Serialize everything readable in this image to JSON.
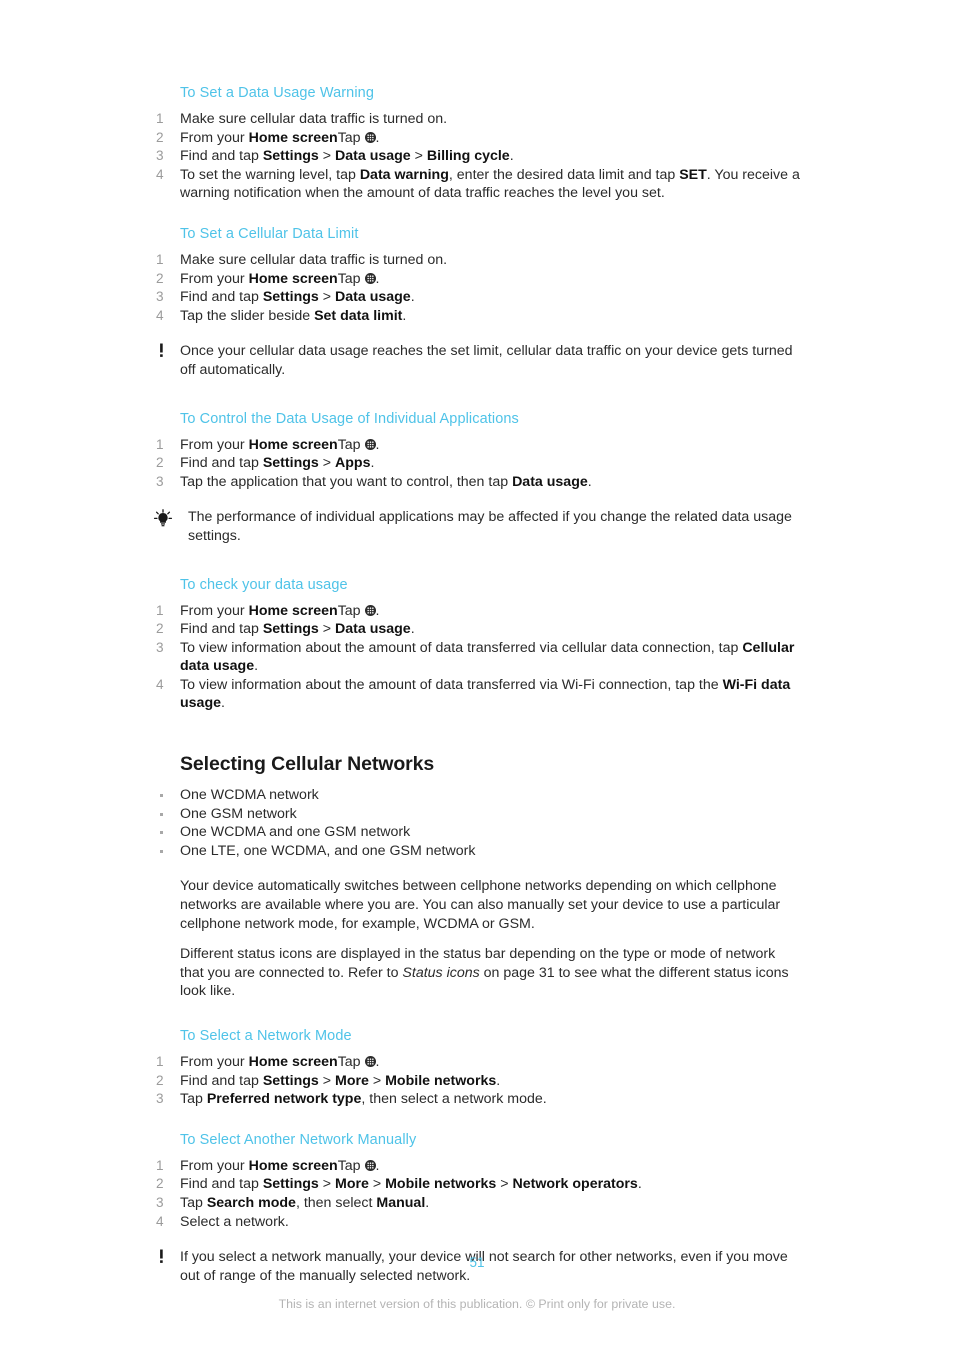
{
  "document": {
    "page_number": "51",
    "footer_note": "This is an internet version of this publication. © Print only for private use.",
    "accent_color": "#4FC3E8",
    "body_color": "#2b2b2b"
  },
  "sections": [
    {
      "id": "data-usage-warning",
      "heading": "To Set a Data Usage Warning",
      "steps": [
        {
          "num": "1",
          "text": "Make sure cellular data traffic is turned on."
        },
        {
          "num": "2",
          "text": "From your Home screen, tap [app-drawer-icon]."
        },
        {
          "num": "3",
          "text": "Find and tap Settings > Data usage > Billing cycle."
        },
        {
          "num": "4",
          "text": "To set the warning level, tap Data warning, enter the desired data limit and tap SET. You receive a warning notification when the amount of data traffic reaches the level you set."
        }
      ]
    },
    {
      "id": "cellular-data-limit",
      "heading": "To Set a Cellular Data Limit",
      "steps": [
        {
          "num": "1",
          "text": "Make sure cellular data traffic is turned on."
        },
        {
          "num": "2",
          "text": "From your Home screen, tap [app-drawer-icon]."
        },
        {
          "num": "3",
          "text": "Find and tap Settings > Data usage."
        },
        {
          "num": "4",
          "text": "Tap the slider beside Set data limit."
        }
      ],
      "note": {
        "type": "warning",
        "icon": "exclamation-icon",
        "text": "Once your cellular data usage reaches the set limit, cellular data traffic on your device gets turned off automatically."
      }
    },
    {
      "id": "control-individual-applications",
      "heading": "To Control the Data Usage of Individual Applications",
      "steps": [
        {
          "num": "1",
          "text": "From your Home screen, tap [app-drawer-icon]."
        },
        {
          "num": "2",
          "text": "Find and tap Settings > Apps."
        },
        {
          "num": "3",
          "text": "Tap the application that you want to control, then tap Data usage."
        }
      ],
      "note": {
        "type": "tip",
        "icon": "lightbulb-icon",
        "text": "The performance of individual applications may be affected if you change the related data usage settings."
      }
    },
    {
      "id": "check-your-data-usage",
      "heading": "To check your data usage",
      "steps": [
        {
          "num": "1",
          "text": "From your Home screen, tap [app-drawer-icon]."
        },
        {
          "num": "2",
          "text": "Find and tap Settings > Data usage."
        },
        {
          "num": "3",
          "text": "To view information about the amount of data transferred via cellular data connection, tap Cellular data usage."
        },
        {
          "num": "4",
          "text": "To view information about the amount of data transferred via Wi-Fi connection, tap the Wi-Fi data usage."
        }
      ]
    }
  ],
  "main_section": {
    "heading": "Selecting Cellular Networks",
    "bullets": [
      "One WCDMA network",
      "One GSM network",
      "One WCDMA and one GSM network",
      "One LTE, one WCDMA, and one GSM network"
    ],
    "paragraphs": [
      "Your device automatically switches between cellphone networks depending on which cellphone networks are available where you are. You can also manually set your device to use a particular cellphone network mode, for example, WCDMA or GSM.",
      "Different status icons are displayed in the status bar depending on the type or mode of network that you are connected to. Refer to Status icons on page 31 to see what the different status icons look like."
    ],
    "paragraph2_parts": {
      "lead": "Different status icons are displayed in the status bar depending on the type or mode of network that you are connected to. Refer to ",
      "italic_ref": "Status icons",
      "tail": " on page 31 to see what the different status icons look like."
    }
  },
  "sections_after": [
    {
      "id": "select-network-mode",
      "heading": "To Select a Network Mode",
      "steps": [
        {
          "num": "1",
          "text": "From your Home screen, tap [app-drawer-icon]."
        },
        {
          "num": "2",
          "text": "Find and tap Settings > More > Mobile networks."
        },
        {
          "num": "3",
          "text": "Tap Preferred network type, then select a network mode."
        }
      ]
    },
    {
      "id": "select-another-network-manually",
      "heading": "To Select Another Network Manually",
      "steps": [
        {
          "num": "1",
          "text": "From your Home screen, tap [app-drawer-icon]."
        },
        {
          "num": "2",
          "text": "Find and tap Settings > More > Mobile networks > Network operators."
        },
        {
          "num": "3",
          "text": "Tap Search mode, then select Manual."
        },
        {
          "num": "4",
          "text": "Select a network."
        }
      ],
      "note": {
        "type": "warning",
        "icon": "exclamation-icon",
        "text": "If you select a network manually, your device will not search for other networks, even if you move out of range of the manually selected network."
      }
    }
  ],
  "inline_labels": {
    "home_screen": "Home screen",
    "settings": "Settings",
    "data_usage": "Data usage",
    "billing_cycle": "Billing cycle",
    "data_warning": "Data warning",
    "set": "SET",
    "set_data_limit": "Set data limit",
    "apps": "Apps",
    "cellular_data_usage": "Cellular data usage",
    "wifi_data_usage": "Wi-Fi data usage",
    "more": "More",
    "mobile_networks": "Mobile networks",
    "preferred_network_type": "Preferred network type",
    "network_operators": "Network operators",
    "search_mode": "Search mode",
    "manual": "Manual",
    "status_icons": "Status icons"
  },
  "text_fragments": {
    "make_sure_traffic": "Make sure cellular data traffic is turned on.",
    "from_your": "From your ",
    "tap_": "Tap ",
    "find_and_tap": "Find and tap ",
    "period": ".",
    "step4_warning_a": "To set the warning level, tap ",
    "step4_warning_b": ", enter the desired data limit and tap ",
    "step4_warning_c": ". You receive a warning notification when the amount of data traffic reaches the level you set.",
    "tap_slider_beside": "Tap the slider beside ",
    "tap_app_control": "Tap the application that you want to control, then tap ",
    "view_cellular_a": "To view information about the amount of data transferred via cellular data connection, tap ",
    "view_wifi_a": "To view information about the amount of data transferred via Wi-Fi connection, tap the ",
    "then_select_mode": ", then select a network mode.",
    "then_select": ", then select ",
    "select_a_network": "Select a network.",
    "on_page_31": " on page 31 to see what the different status icons look like.",
    "refer_to": "Different status icons are displayed in the status bar depending on the type or mode of network that you are connected to. Refer to ",
    "gt": ">"
  }
}
